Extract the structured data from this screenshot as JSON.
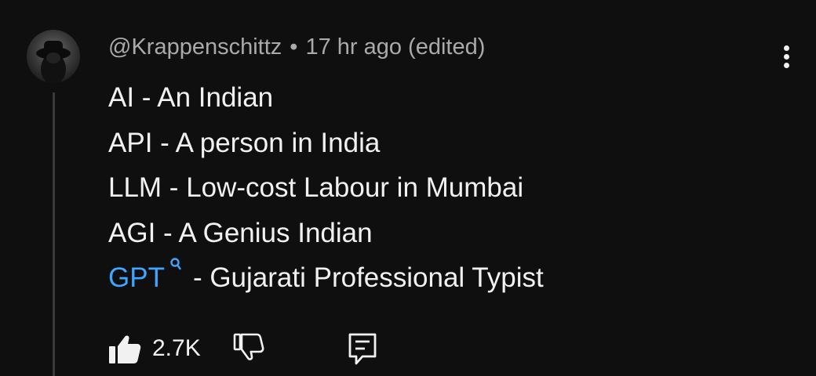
{
  "comment": {
    "author": "@Krappenschittz",
    "separator": "•",
    "time": "17 hr ago",
    "edited": "(edited)",
    "lines": [
      {
        "text": "AI - An Indian"
      },
      {
        "text": "API - A person in India"
      },
      {
        "text": "LLM - Low-cost Labour in Mumbai"
      },
      {
        "text": "AGI - A Genius Indian"
      }
    ],
    "last_line": {
      "link": "GPT",
      "link_icon": "search-icon",
      "rest": "- Gujarati Professional Typist"
    },
    "likes": "2.7K"
  },
  "icons": {
    "more": "more-vertical-icon",
    "like": "thumbs-up-icon",
    "dislike": "thumbs-down-icon",
    "reply": "reply-comment-icon"
  },
  "colors": {
    "background": "#0f0f0f",
    "text": "#f1f1f1",
    "meta": "#aaaaaa",
    "link": "#3ea6ff"
  }
}
